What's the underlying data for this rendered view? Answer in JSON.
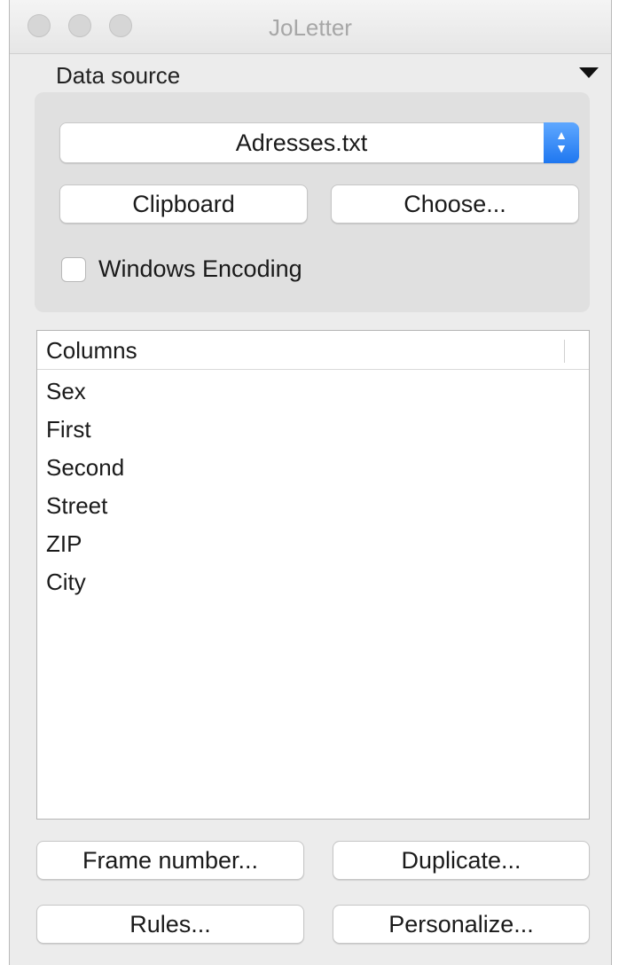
{
  "window": {
    "title": "JoLetter"
  },
  "data_source": {
    "header": "Data source",
    "file_popup": {
      "selected": "Adresses.txt"
    },
    "buttons": {
      "clipboard": "Clipboard",
      "choose": "Choose..."
    },
    "windows_encoding": {
      "label": "Windows Encoding",
      "checked": false
    }
  },
  "columns_table": {
    "header": "Columns",
    "rows": [
      "Sex",
      "First",
      "Second",
      "Street",
      "ZIP",
      "City"
    ]
  },
  "actions": {
    "frame_number": "Frame number...",
    "duplicate": "Duplicate...",
    "rules": "Rules...",
    "personalize": "Personalize..."
  },
  "colors": {
    "accent": "#1f77f0",
    "window_bg": "#ececec",
    "group_bg": "#e0e0e0"
  }
}
